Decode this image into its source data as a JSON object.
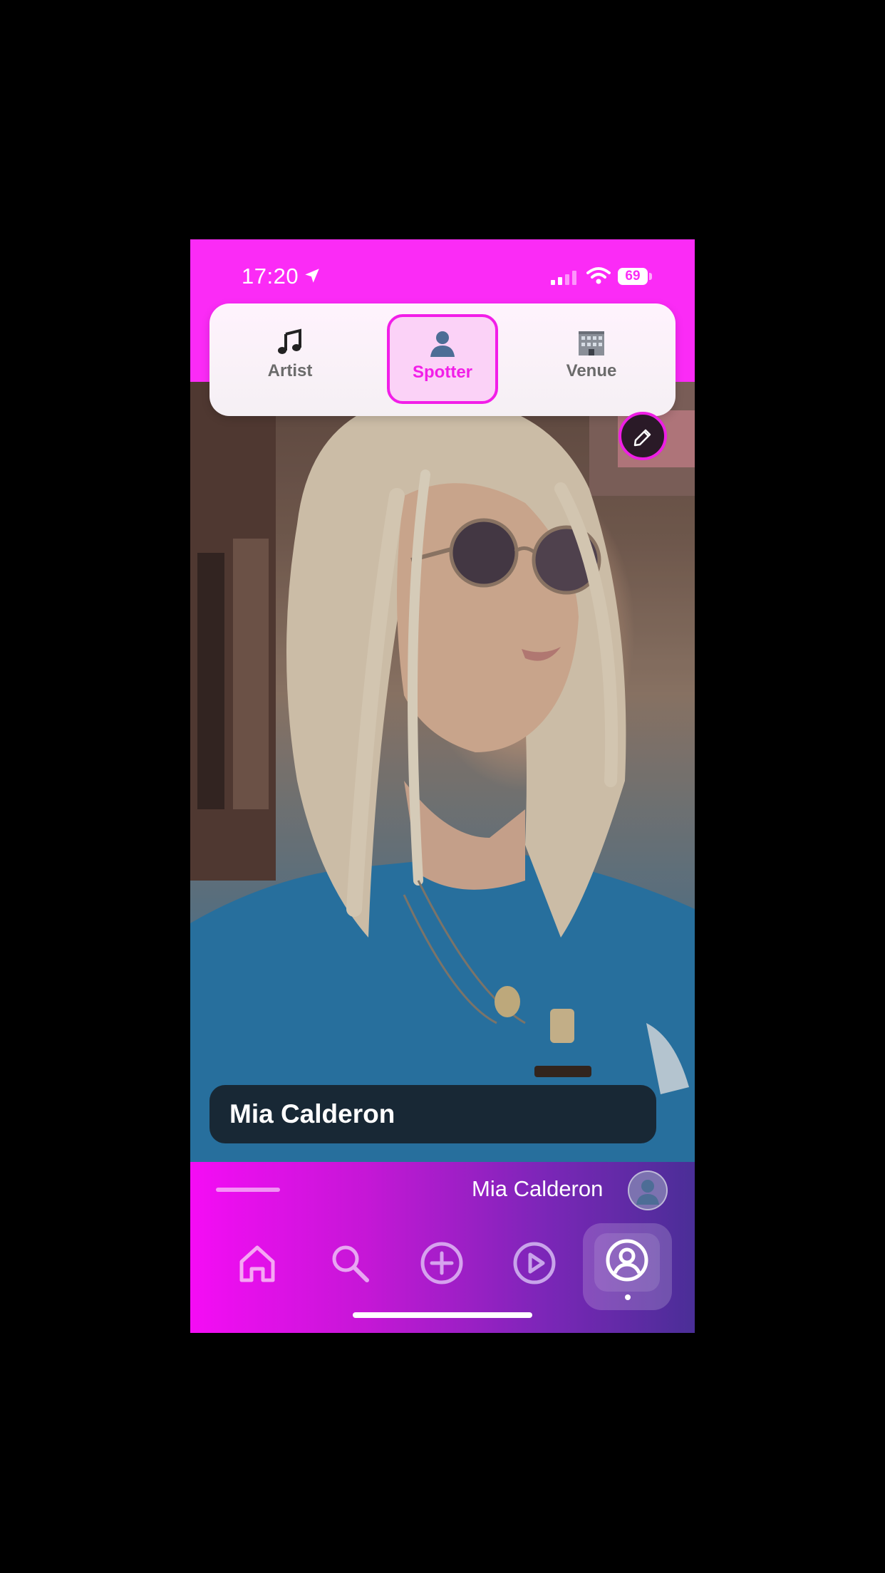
{
  "status_bar": {
    "time": "17:20",
    "battery": "69"
  },
  "role_selector": {
    "options": [
      {
        "label": "Artist",
        "icon": "musical-notes-icon"
      },
      {
        "label": "Spotter",
        "icon": "person-silhouette-icon",
        "selected": true
      },
      {
        "label": "Venue",
        "icon": "office-building-icon"
      }
    ]
  },
  "profile": {
    "name": "Mia Calderon"
  },
  "bottom_bar": {
    "user_name": "Mia Calderon",
    "nav": [
      "home-icon",
      "search-icon",
      "add-icon",
      "play-icon",
      "profile-icon"
    ],
    "active_tab": "profile"
  },
  "colors": {
    "accent": "#f21ee8",
    "top_band": "#fb2bf6",
    "gradient_end": "#4a2e97"
  }
}
